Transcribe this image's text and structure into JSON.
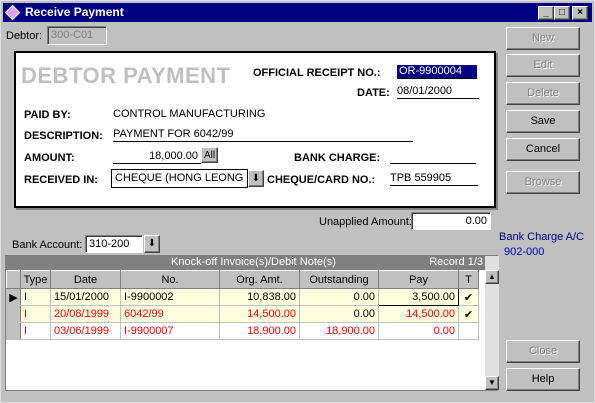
{
  "window": {
    "title": "Receive Payment",
    "min_glyph": "_",
    "max_glyph": "□",
    "close_glyph": "×"
  },
  "debtor": {
    "label": "Debtor:",
    "value": "300-C01"
  },
  "receipt": {
    "heading": "DEBTOR PAYMENT",
    "receipt_no_label": "OFFICIAL RECEIPT NO.:",
    "receipt_no": "OR-9900004",
    "date_label": "DATE:",
    "date": "08/01/2000",
    "paid_by_label": "PAID BY:",
    "paid_by": "CONTROL MANUFACTURING",
    "description_label": "DESCRIPTION:",
    "description": "PAYMENT FOR 6042/99",
    "amount_label": "AMOUNT:",
    "amount": "18,000.00",
    "all_button": "All",
    "bank_charge_label": "BANK CHARGE:",
    "bank_charge": "",
    "received_in_label": "RECEIVED IN:",
    "received_in": "CHEQUE (HONG LEONG B",
    "cheque_label": "CHEQUE/CARD NO.:",
    "cheque_no": "TPB 559905"
  },
  "unapplied": {
    "label": "Unapplied Amount:",
    "value": "0.00"
  },
  "bank_account": {
    "label": "Bank Account:",
    "value": "310-200"
  },
  "bank_charge_ac": {
    "label": "Bank Charge A/C",
    "value": "902-000"
  },
  "buttons": {
    "new": "New",
    "edit": "Edit",
    "delete": "Delete",
    "save": "Save",
    "cancel": "Cancel",
    "browse": "Browse",
    "close": "Close",
    "help": "Help"
  },
  "grid": {
    "caption": "Knock-off Invoice(s)/Debit Note(s)",
    "record": "Record 1/3",
    "columns": [
      "Type",
      "Date",
      "No.",
      "Org. Amt.",
      "Outstanding",
      "Pay",
      "T"
    ],
    "rows": [
      {
        "type": "I",
        "date": "15/01/2000",
        "no": "I-9900002",
        "org": "10,838.00",
        "out": "0.00",
        "pay": "3,500.00",
        "t": "✔"
      },
      {
        "type": "I",
        "date": "20/08/1999",
        "no": "6042/99",
        "org": "14,500.00",
        "out": "0.00",
        "pay": "14,500.00",
        "t": "✔"
      },
      {
        "type": "I",
        "date": "03/06/1999",
        "no": "I-9900007",
        "org": "18,900.00",
        "out": "18,900.00",
        "pay": "0.00",
        "t": ""
      }
    ]
  },
  "colors": {
    "titlebar": "#000080",
    "row_odd": "#ffffe0",
    "row_even": "#ffffff",
    "red_text": "#ff0000",
    "link_blue": "#0000c0"
  }
}
